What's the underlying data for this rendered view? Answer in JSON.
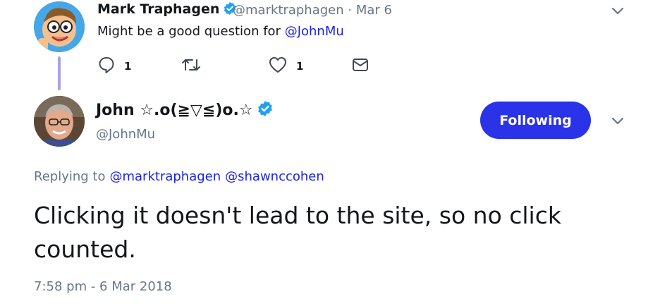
{
  "parent_tweet": {
    "author_name": "Mark Traphagen",
    "author_handle": "@marktraphagen",
    "date_separator": "·",
    "date": "Mar 6",
    "text_prefix": "Might be a good question for ",
    "mention": "@JohnMu",
    "reply_count": "1",
    "like_count": "1"
  },
  "main_tweet": {
    "author_name": "John ☆.o(≧▽≦)o.☆",
    "author_handle": "@JohnMu",
    "follow_label": "Following",
    "replying_prefix": "Replying to",
    "replying_to": [
      "@marktraphagen",
      "@shawnccohen"
    ],
    "text": "Clicking it doesn't lead to the site, so no click counted.",
    "timestamp": "7:58 pm - 6 Mar 2018"
  },
  "colors": {
    "accent": "#2a33e8",
    "mention": "#1b24e6",
    "verified": "#1da1f2",
    "thread_line": "#a9a0ee",
    "secondary_text": "#657786"
  },
  "icons": [
    "verified-badge-icon",
    "chevron-down-icon",
    "reply-icon",
    "retweet-icon",
    "like-icon",
    "message-icon"
  ]
}
